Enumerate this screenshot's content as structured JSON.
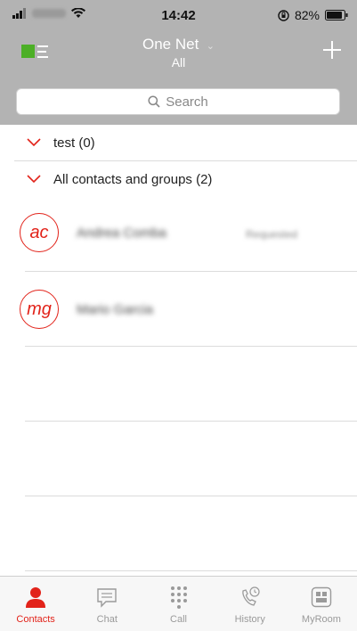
{
  "status_bar": {
    "time": "14:42",
    "battery": "82%"
  },
  "header": {
    "title": "One Net",
    "subtitle": "All"
  },
  "search": {
    "placeholder": "Search"
  },
  "groups": [
    {
      "label": "test (0)"
    },
    {
      "label": "All contacts and groups (2)"
    }
  ],
  "contacts": [
    {
      "initials": "ac",
      "name": "Andrea Comba",
      "status": "Requested"
    },
    {
      "initials": "mg",
      "name": "Mario Garcia",
      "status": ""
    }
  ],
  "tabs": [
    {
      "label": "Contacts",
      "icon": "person-icon",
      "active": true
    },
    {
      "label": "Chat",
      "icon": "chat-bubble-icon",
      "active": false
    },
    {
      "label": "Call",
      "icon": "dialpad-icon",
      "active": false
    },
    {
      "label": "History",
      "icon": "call-history-icon",
      "active": false
    },
    {
      "label": "MyRoom",
      "icon": "myroom-icon",
      "active": false
    }
  ],
  "colors": {
    "accent": "#e2231a",
    "header_bg": "#b3b3b3",
    "presence_green": "#4caf26"
  }
}
